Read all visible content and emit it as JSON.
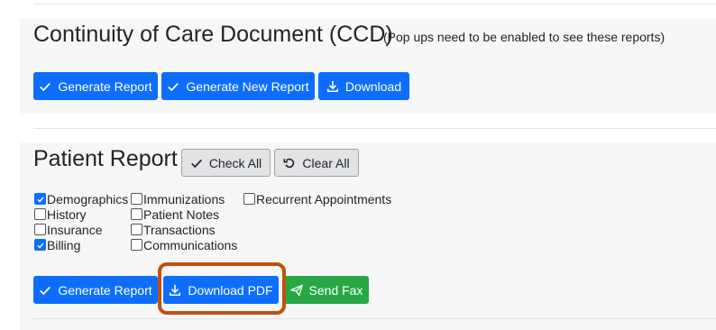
{
  "ccd": {
    "title": "Continuity of Care Document (CCD)",
    "note": "(Pop ups need to be enabled to see these reports)",
    "buttons": {
      "generate_report": "Generate Report",
      "generate_new_report": "Generate New Report",
      "download": "Download"
    }
  },
  "patient_report": {
    "title": "Patient Report",
    "check_all": "Check All",
    "clear_all": "Clear All",
    "options": [
      {
        "label": "Demographics",
        "checked": true
      },
      {
        "label": "History",
        "checked": false
      },
      {
        "label": "Insurance",
        "checked": false
      },
      {
        "label": "Billing",
        "checked": true
      },
      {
        "label": "Immunizations",
        "checked": false
      },
      {
        "label": "Patient Notes",
        "checked": false
      },
      {
        "label": "Transactions",
        "checked": false
      },
      {
        "label": "Communications",
        "checked": false
      },
      {
        "label": "Recurrent Appointments",
        "checked": false
      }
    ],
    "buttons": {
      "generate_report": "Generate Report",
      "download_pdf": "Download PDF",
      "send_fax": "Send Fax"
    }
  },
  "colors": {
    "primary": "#0d6efd",
    "success": "#28a745",
    "highlight": "#c0510c",
    "panel": "#f7f7f7"
  }
}
